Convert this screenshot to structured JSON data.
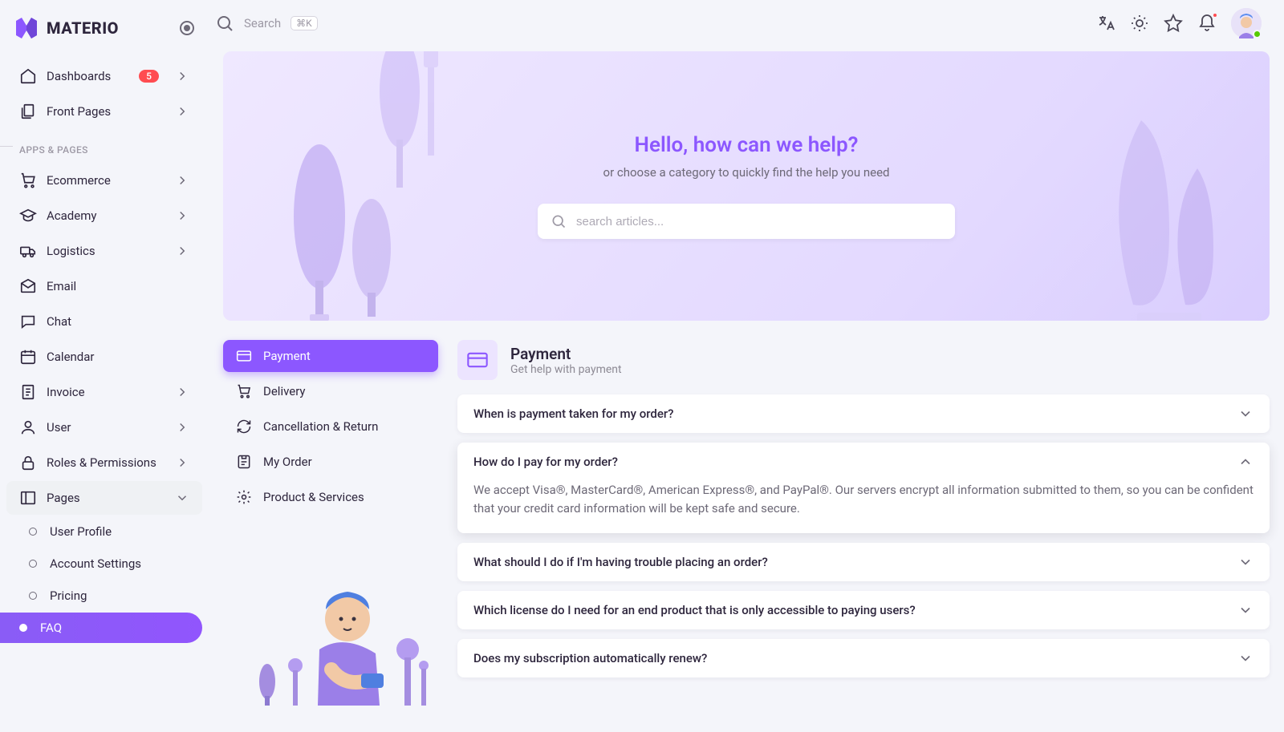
{
  "brand": "MATERIO",
  "search": {
    "label": "Search",
    "kbd": "⌘K",
    "hero_placeholder": "search articles..."
  },
  "sidebar": {
    "dashboards": {
      "label": "Dashboards",
      "badge": "5"
    },
    "front_pages": "Front Pages",
    "section1": "APPS & PAGES",
    "items": [
      {
        "label": "Ecommerce",
        "icon": "cart",
        "expandable": true
      },
      {
        "label": "Academy",
        "icon": "academy",
        "expandable": true
      },
      {
        "label": "Logistics",
        "icon": "truck",
        "expandable": true
      },
      {
        "label": "Email",
        "icon": "mail",
        "expandable": false
      },
      {
        "label": "Chat",
        "icon": "chat",
        "expandable": false
      },
      {
        "label": "Calendar",
        "icon": "calendar",
        "expandable": false
      },
      {
        "label": "Invoice",
        "icon": "invoice",
        "expandable": true
      },
      {
        "label": "User",
        "icon": "user",
        "expandable": true
      },
      {
        "label": "Roles & Permissions",
        "icon": "lock",
        "expandable": true
      },
      {
        "label": "Pages",
        "icon": "pages",
        "expandable": true,
        "open": true
      }
    ],
    "pages_sub": [
      {
        "label": "User Profile",
        "active": false
      },
      {
        "label": "Account Settings",
        "active": false
      },
      {
        "label": "Pricing",
        "active": false
      },
      {
        "label": "FAQ",
        "active": true
      }
    ]
  },
  "hero": {
    "title": "Hello, how can we help?",
    "subtitle": "or choose a category to quickly find the help you need"
  },
  "tabs": [
    {
      "label": "Payment",
      "icon": "card",
      "active": true
    },
    {
      "label": "Delivery",
      "icon": "delivery",
      "active": false
    },
    {
      "label": "Cancellation & Return",
      "icon": "refresh",
      "active": false
    },
    {
      "label": "My Order",
      "icon": "order",
      "active": false
    },
    {
      "label": "Product & Services",
      "icon": "settings",
      "active": false
    }
  ],
  "faq": {
    "title": "Payment",
    "subtitle": "Get help with payment",
    "items": [
      {
        "q": "When is payment taken for my order?",
        "a": "",
        "open": false
      },
      {
        "q": "How do I pay for my order?",
        "a": "We accept Visa®, MasterCard®, American Express®, and PayPal®. Our servers encrypt all information submitted to them, so you can be confident that your credit card information will be kept safe and secure.",
        "open": true
      },
      {
        "q": "What should I do if I'm having trouble placing an order?",
        "a": "",
        "open": false
      },
      {
        "q": "Which license do I need for an end product that is only accessible to paying users?",
        "a": "",
        "open": false
      },
      {
        "q": "Does my subscription automatically renew?",
        "a": "",
        "open": false
      }
    ]
  },
  "colors": {
    "primary": "#8c57ff",
    "danger": "#ff4c51",
    "success": "#56ca00"
  }
}
